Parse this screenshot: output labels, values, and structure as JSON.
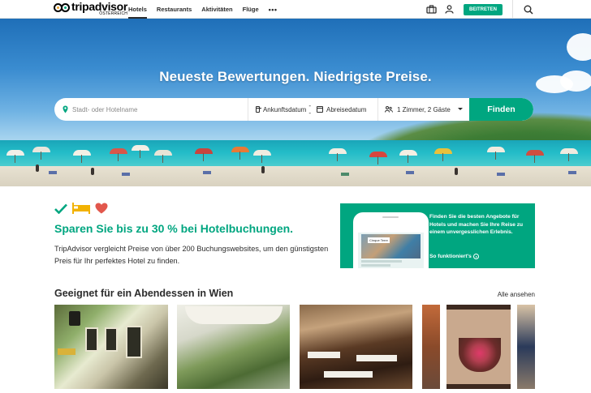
{
  "header": {
    "logo_text": "tripadvisor",
    "logo_sub": "ÖSTERREICH",
    "nav": [
      {
        "label": "Hotels",
        "active": true
      },
      {
        "label": "Restaurants",
        "active": false
      },
      {
        "label": "Aktivitäten",
        "active": false
      },
      {
        "label": "Flüge",
        "active": false
      }
    ],
    "more_label": "•••",
    "join_label": "BEITRETEN",
    "icons": [
      "suitcase-icon",
      "user-icon",
      "search-icon"
    ]
  },
  "hero": {
    "title": "Neueste Bewertungen. Niedrigste Preise.",
    "search": {
      "location_placeholder": "Stadt- oder Hotelname",
      "checkin": "Ankunftsdatum",
      "separator": "--",
      "checkout": "Abreisedatum",
      "guests": "1 Zimmer, 2 Gäste",
      "button": "Finden"
    }
  },
  "promo": {
    "title": "Sparen Sie bis zu 30 % bei Hotelbuchungen.",
    "text": "TripAdvisor vergleicht Preise von über 200 Buchungswebsites, um den günstigsten Preis für Ihr perfektes Hotel zu finden.",
    "icons": [
      "check-icon",
      "bed-icon",
      "heart-icon"
    ],
    "app": {
      "text": "Finden Sie die besten Angebote für Hotels und machen Sie Ihre Reise zu einem unvergesslichen Erlebnis.",
      "link": "So funktioniert's",
      "screen_tag": "Cinque Terre"
    }
  },
  "section": {
    "title": "Geeignet für ein Abendessen in Wien",
    "see_all": "Alle ansehen"
  },
  "colors": {
    "brand_green": "#00a680",
    "heart_red": "#e2574c",
    "bed_yellow": "#f2b203"
  }
}
